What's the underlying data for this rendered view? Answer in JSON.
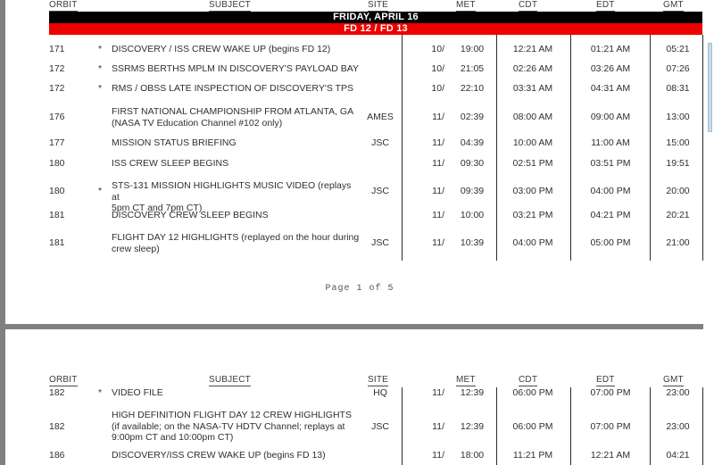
{
  "document": {
    "type": "nasa-tv-schedule",
    "page_indicator": "Page 1 of 5"
  },
  "columns": {
    "orbit": "ORBIT",
    "subject": "SUBJECT",
    "site": "SITE",
    "met": "MET",
    "cdt": "CDT",
    "edt": "EDT",
    "gmt": "GMT"
  },
  "colors": {
    "banner_date_bg": "#000000",
    "banner_fd_bg": "#ee0000",
    "banner_text": "#ffffff",
    "page_gutter": "#808080",
    "scrollbar_thumb": "#c6dcea"
  },
  "page1": {
    "banner_date": "FRIDAY, APRIL 16",
    "banner_fd": "FD 12 / FD 13",
    "page_indicator": "Page 1 of 5",
    "rows": [
      {
        "orbit": "171",
        "star": "*",
        "subject": "DISCOVERY / ISS CREW WAKE UP (begins FD 12)",
        "site": "",
        "met_day": "10/",
        "met": "19:00",
        "cdt": "12:21 AM",
        "edt": "01:21 AM",
        "gmt": "05:21"
      },
      {
        "orbit": "172",
        "star": "*",
        "subject": "SSRMS BERTHS MPLM IN DISCOVERY'S PAYLOAD BAY",
        "site": "",
        "met_day": "10/",
        "met": "21:05",
        "cdt": "02:26 AM",
        "edt": "03:26 AM",
        "gmt": "07:26"
      },
      {
        "orbit": "172",
        "star": "*",
        "subject": "RMS / OBSS LATE INSPECTION OF DISCOVERY'S TPS",
        "site": "",
        "met_day": "10/",
        "met": "22:10",
        "cdt": "03:31 AM",
        "edt": "04:31 AM",
        "gmt": "08:31"
      },
      {
        "orbit": "176",
        "star": "",
        "subject": "FIRST NATIONAL CHAMPIONSHIP FROM ATLANTA, GA\n(NASA TV Education Channel #102 only)",
        "site": "AMES",
        "met_day": "11/",
        "met": "02:39",
        "cdt": "08:00 AM",
        "edt": "09:00 AM",
        "gmt": "13:00"
      },
      {
        "orbit": "177",
        "star": "",
        "subject": "MISSION STATUS BRIEFING",
        "site": "JSC",
        "met_day": "11/",
        "met": "04:39",
        "cdt": "10:00 AM",
        "edt": "11:00 AM",
        "gmt": "15:00"
      },
      {
        "orbit": "180",
        "star": "",
        "subject": "ISS CREW SLEEP BEGINS",
        "site": "",
        "met_day": "11/",
        "met": "09:30",
        "cdt": "02:51 PM",
        "edt": "03:51 PM",
        "gmt": "19:51"
      },
      {
        "orbit": "180",
        "star": "*",
        "subject": "STS-131 MISSION HIGHLIGHTS MUSIC VIDEO (replays at\n5pm CT and 7pm CT)",
        "site": "JSC",
        "met_day": "11/",
        "met": "09:39",
        "cdt": "03:00 PM",
        "edt": "04:00 PM",
        "gmt": "20:00"
      },
      {
        "orbit": "181",
        "star": "",
        "subject": "DISCOVERY CREW SLEEP BEGINS",
        "site": "",
        "met_day": "11/",
        "met": "10:00",
        "cdt": "03:21 PM",
        "edt": "04:21 PM",
        "gmt": "20:21"
      },
      {
        "orbit": "181",
        "star": "",
        "subject": "FLIGHT DAY 12 HIGHLIGHTS (replayed on the hour during\ncrew sleep)",
        "site": "JSC",
        "met_day": "11/",
        "met": "10:39",
        "cdt": "04:00 PM",
        "edt": "05:00 PM",
        "gmt": "21:00"
      }
    ]
  },
  "page2": {
    "rows": [
      {
        "orbit": "182",
        "star": "*",
        "subject": "VIDEO FILE",
        "site": "HQ",
        "met_day": "11/",
        "met": "12:39",
        "cdt": "06:00 PM",
        "edt": "07:00 PM",
        "gmt": "23:00"
      },
      {
        "orbit": "182",
        "star": "",
        "subject": "HIGH DEFINITION FLIGHT DAY 12 CREW HIGHLIGHTS\n(if available; on the NASA-TV HDTV Channel; replays at\n9:00pm CT and 10:00pm CT)",
        "site": "JSC",
        "met_day": "11/",
        "met": "12:39",
        "cdt": "06:00 PM",
        "edt": "07:00 PM",
        "gmt": "23:00"
      },
      {
        "orbit": "186",
        "star": "",
        "subject": "DISCOVERY/ISS CREW WAKE UP (begins FD 13)",
        "site": "",
        "met_day": "11/",
        "met": "18:00",
        "cdt": "11:21 PM",
        "edt": "12:21 AM",
        "gmt": "04:21"
      }
    ]
  }
}
